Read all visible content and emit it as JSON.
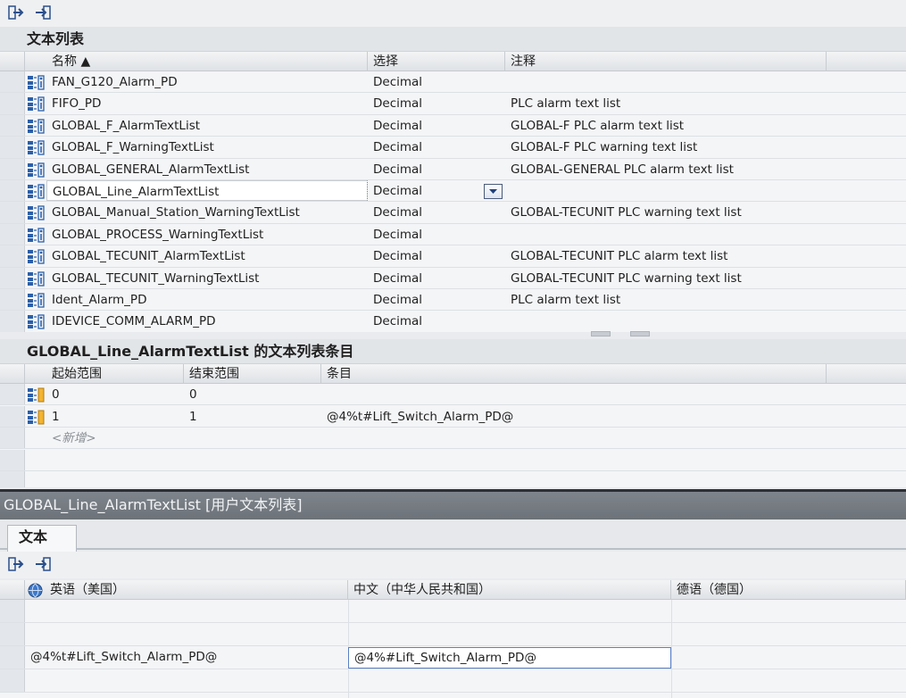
{
  "toolbar_icons": [
    "insert-row-icon",
    "add-row-icon"
  ],
  "text_lists": {
    "title": "文本列表",
    "columns": {
      "name": "名称 ▲",
      "selection": "选择",
      "comment": "注释"
    },
    "rows": [
      {
        "name": "FAN_G120_Alarm_PD",
        "selection": "Decimal",
        "comment": ""
      },
      {
        "name": "FIFO_PD",
        "selection": "Decimal",
        "comment": "PLC alarm text list"
      },
      {
        "name": "GLOBAL_F_AlarmTextList",
        "selection": "Decimal",
        "comment": "GLOBAL-F PLC alarm text list"
      },
      {
        "name": "GLOBAL_F_WarningTextList",
        "selection": "Decimal",
        "comment": "GLOBAL-F PLC warning text list"
      },
      {
        "name": "GLOBAL_GENERAL_AlarmTextList",
        "selection": "Decimal",
        "comment": "GLOBAL-GENERAL PLC alarm text list"
      },
      {
        "name": "GLOBAL_Line_AlarmTextList",
        "selection": "Decimal",
        "comment": ""
      },
      {
        "name": "GLOBAL_Manual_Station_WarningTextList",
        "selection": "Decimal",
        "comment": "GLOBAL-TECUNIT PLC warning text list"
      },
      {
        "name": "GLOBAL_PROCESS_WarningTextList",
        "selection": "Decimal",
        "comment": ""
      },
      {
        "name": "GLOBAL_TECUNIT_AlarmTextList",
        "selection": "Decimal",
        "comment": "GLOBAL-TECUNIT PLC alarm text list"
      },
      {
        "name": "GLOBAL_TECUNIT_WarningTextList",
        "selection": "Decimal",
        "comment": "GLOBAL-TECUNIT PLC warning text list"
      },
      {
        "name": "Ident_Alarm_PD",
        "selection": "Decimal",
        "comment": "PLC alarm text list"
      },
      {
        "name": "IDEVICE_COMM_ALARM_PD",
        "selection": "Decimal",
        "comment": ""
      }
    ]
  },
  "entries": {
    "title": "GLOBAL_Line_AlarmTextList 的文本列表条目",
    "columns": {
      "start": "起始范围",
      "end": "结束范围",
      "entry": "条目"
    },
    "rows": [
      {
        "start": "0",
        "end": "0",
        "entry": ""
      },
      {
        "start": "1",
        "end": "1",
        "entry": "@4%t#Lift_Switch_Alarm_PD@"
      }
    ],
    "add_new": "<新增>"
  },
  "editor": {
    "title": "GLOBAL_Line_AlarmTextList [用户文本列表]",
    "tab": "文本",
    "columns": {
      "english": "英语（美国）",
      "chinese": "中文（中华人民共和国）",
      "german": "德语（德国）"
    },
    "english_value": "@4%t#Lift_Switch_Alarm_PD@",
    "chinese_value": "@4%#Lift_Switch_Alarm_PD@"
  },
  "colors": {
    "accent": "#2b5fa8",
    "editor_bar": "#737980"
  }
}
